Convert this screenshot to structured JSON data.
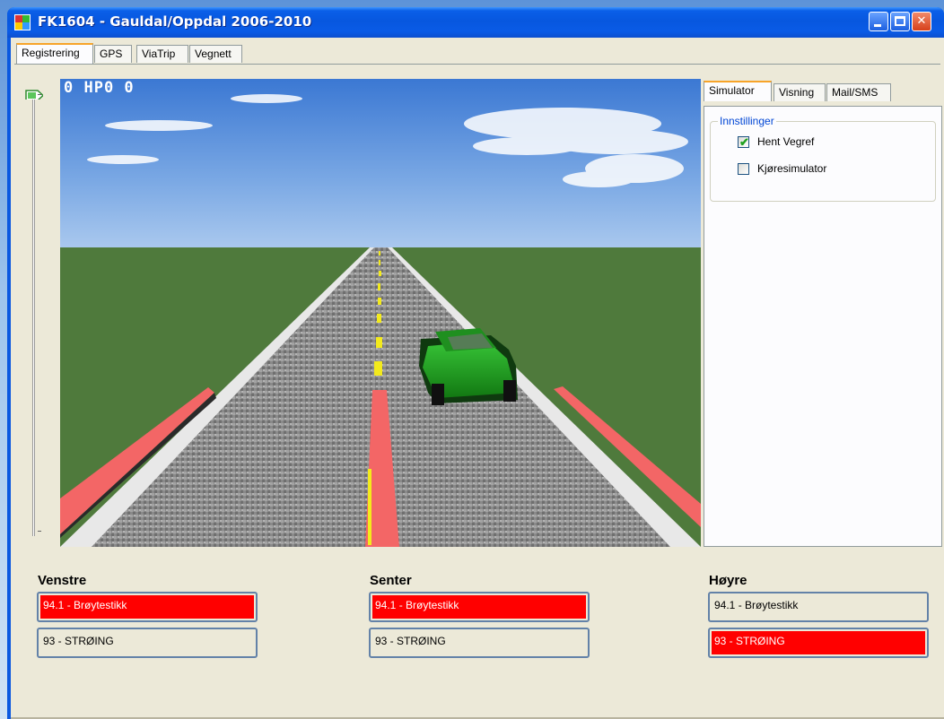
{
  "window": {
    "title": "FK1604 - Gauldal/Oppdal 2006-2010"
  },
  "main_tabs": [
    {
      "label": "Registrering",
      "active": true
    },
    {
      "label": "GPS",
      "active": false
    },
    {
      "label": "ViaTrip",
      "active": false
    },
    {
      "label": "Vegnett",
      "active": false
    }
  ],
  "hud": {
    "text": "0 HP0 0"
  },
  "side_tabs": [
    {
      "label": "Simulator",
      "active": true
    },
    {
      "label": "Visning",
      "active": false
    },
    {
      "label": "Mail/SMS",
      "active": false
    }
  ],
  "settings": {
    "group_title": "Innstillinger",
    "options": [
      {
        "label": "Hent Vegref",
        "checked": true
      },
      {
        "label": "Kjøresimulator",
        "checked": false
      }
    ]
  },
  "lanes": {
    "left": {
      "title": "Venstre",
      "items": [
        {
          "label": "94.1 - Brøytestikk",
          "state": "red"
        },
        {
          "label": "93 - STRØING",
          "state": "grey"
        }
      ]
    },
    "center": {
      "title": "Senter",
      "items": [
        {
          "label": "94.1 - Brøytestikk",
          "state": "red"
        },
        {
          "label": "93 - STRØING",
          "state": "grey"
        }
      ]
    },
    "right": {
      "title": "Høyre",
      "items": [
        {
          "label": "94.1 - Brøytestikk",
          "state": "grey"
        },
        {
          "label": "93 - STRØING",
          "state": "red"
        }
      ]
    }
  },
  "colors": {
    "active_red": "#ff0000",
    "inactive_grey": "#ece9d8",
    "xp_blue": "#0a58e0"
  },
  "icons": {
    "app": "app-icon",
    "minimize": "minimize-icon",
    "maximize": "maximize-icon",
    "close": "close-icon"
  }
}
